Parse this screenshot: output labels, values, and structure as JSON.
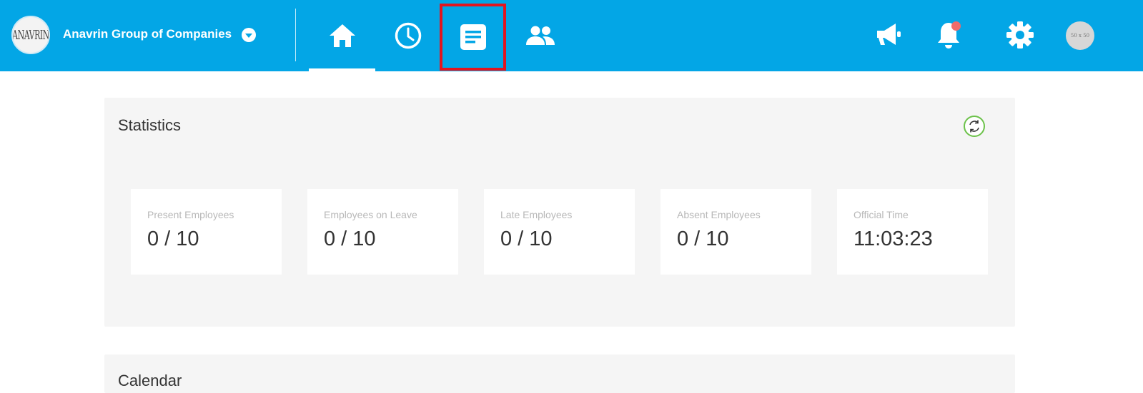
{
  "header": {
    "logo_text": "ANAVRIN",
    "company_name": "Anavrin Group of Companies",
    "avatar_text": "50 x 50",
    "colors": {
      "bar": "#03a6e6",
      "highlight": "#e3151f",
      "notification_dot": "#f06b6b"
    },
    "nav_tabs": [
      {
        "icon": "home-icon",
        "active": true
      },
      {
        "icon": "clock-icon",
        "active": false
      },
      {
        "icon": "document-icon",
        "active": false,
        "highlighted": true
      },
      {
        "icon": "people-icon",
        "active": false
      }
    ],
    "right_icons": [
      "megaphone-icon",
      "bell-icon",
      "gear-icon",
      "avatar"
    ]
  },
  "statistics": {
    "title": "Statistics",
    "refresh_icon": "refresh-icon",
    "cards": [
      {
        "label": "Present Employees",
        "value": "0 / 10"
      },
      {
        "label": "Employees on Leave",
        "value": "0 / 10"
      },
      {
        "label": "Late Employees",
        "value": "0 / 10"
      },
      {
        "label": "Absent Employees",
        "value": "0 / 10"
      },
      {
        "label": "Official Time",
        "value": "11:03:23"
      }
    ]
  },
  "calendar": {
    "title": "Calendar"
  }
}
